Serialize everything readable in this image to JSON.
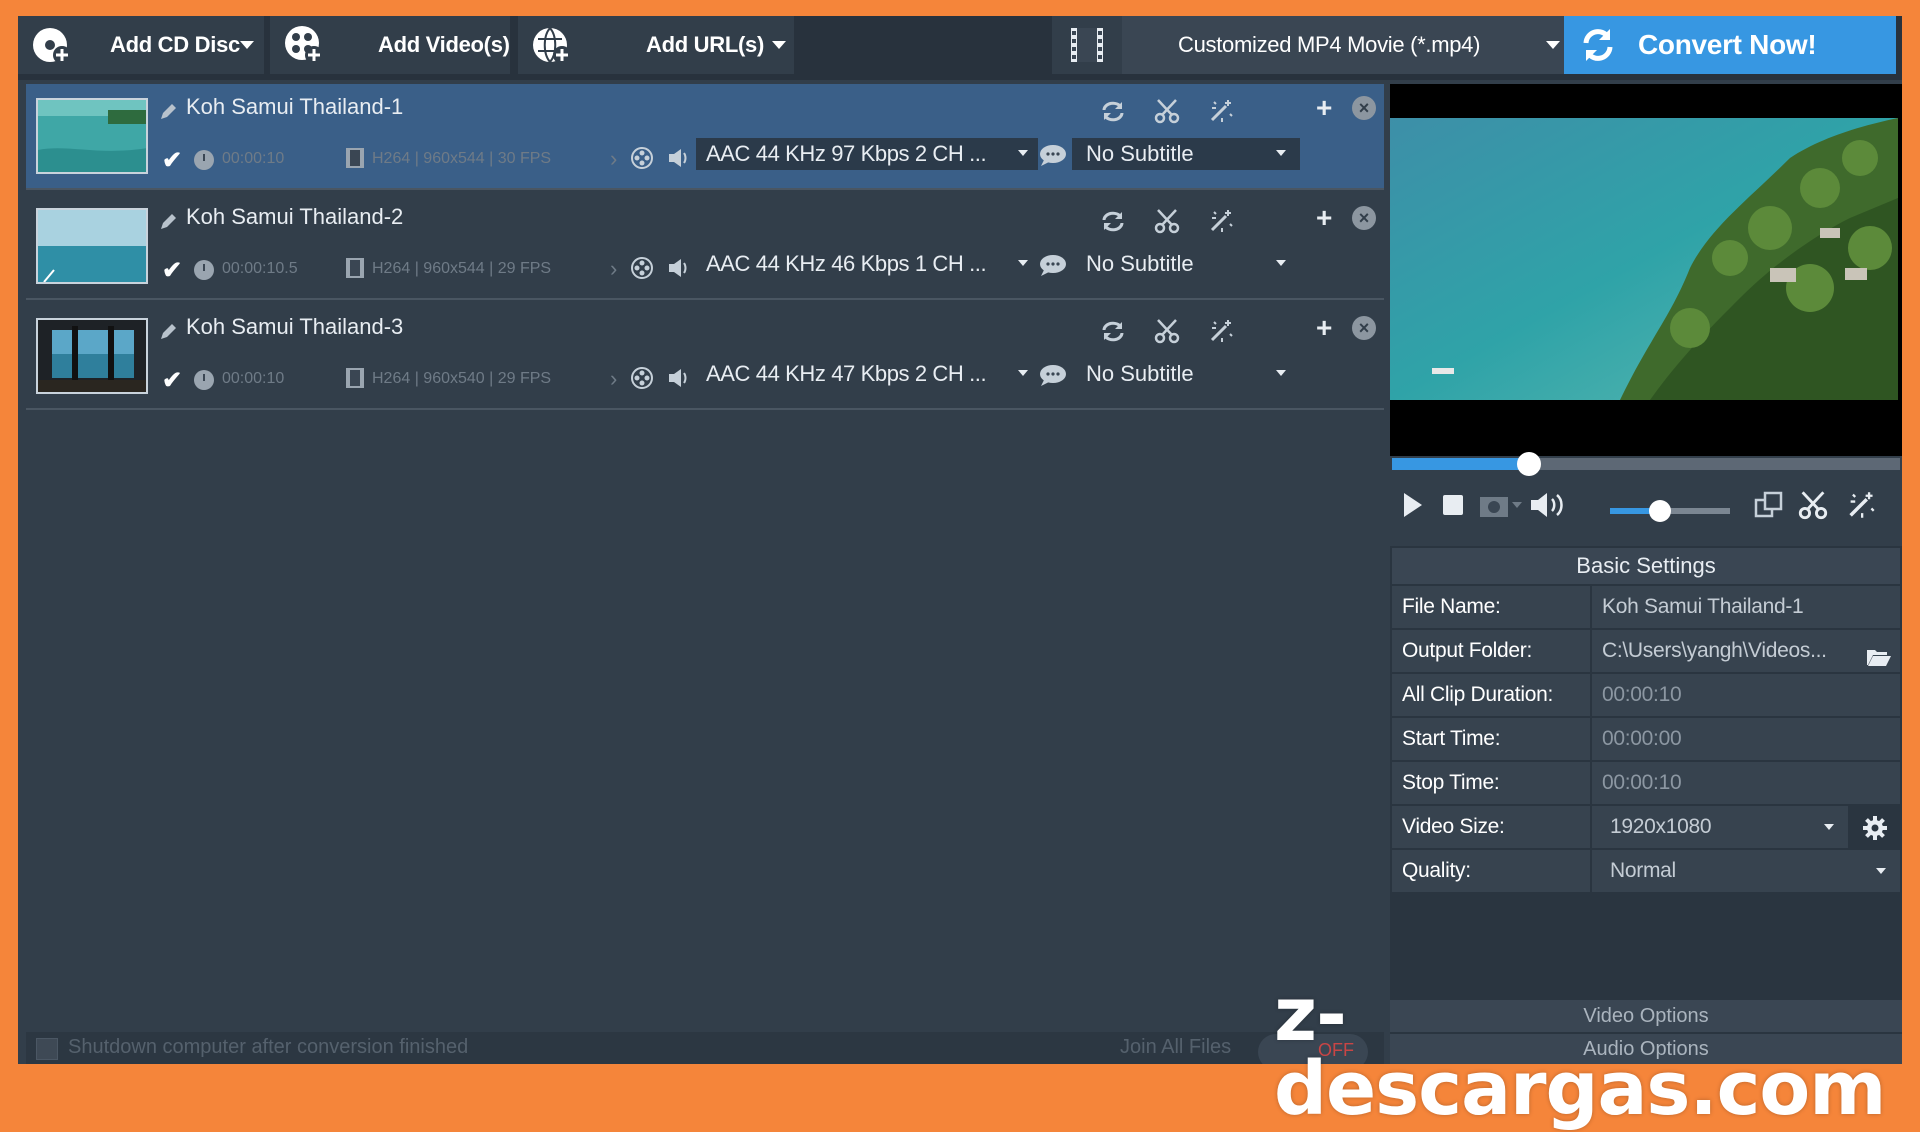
{
  "toolbar": {
    "add_cd_label": "Add CD Disc",
    "add_video_label": "Add Video(s)",
    "add_url_label": "Add URL(s)",
    "output_format": "Customized MP4 Movie (*.mp4)",
    "convert_label": "Convert Now!"
  },
  "files": [
    {
      "name": "Koh Samui Thailand-1",
      "checked": "✔",
      "duration": "00:00:10",
      "video_info": "H264 | 960x544 | 30 FPS",
      "audio": "AAC 44 KHz 97 Kbps 2 CH ...",
      "subtitle": "No Subtitle",
      "selected": true
    },
    {
      "name": "Koh Samui Thailand-2",
      "checked": "✔",
      "duration": "00:00:10.5",
      "video_info": "H264 | 960x544 | 29 FPS",
      "audio": "AAC 44 KHz 46 Kbps 1 CH ...",
      "subtitle": "No Subtitle",
      "selected": false
    },
    {
      "name": "Koh Samui Thailand-3",
      "checked": "✔",
      "duration": "00:00:10",
      "video_info": "H264 | 960x540 | 29 FPS",
      "audio": "AAC 44 KHz 47 Kbps 2 CH ...",
      "subtitle": "No Subtitle",
      "selected": false
    }
  ],
  "bottom": {
    "shutdown_label": "Shutdown computer after conversion finished",
    "join_label": "Join All Files",
    "join_state": "OFF"
  },
  "player": {
    "seek_progress": 0.27,
    "volume_level": 0.42
  },
  "settings": {
    "header": "Basic Settings",
    "rows": [
      {
        "label": "File Name:",
        "value": "Koh Samui Thailand-1"
      },
      {
        "label": "Output Folder:",
        "value": "C:\\Users\\yangh\\Videos..."
      },
      {
        "label": "All Clip Duration:",
        "value": "00:00:10"
      },
      {
        "label": "Start Time:",
        "value": "00:00:00"
      },
      {
        "label": "Stop Time:",
        "value": "00:00:10"
      },
      {
        "label": "Video Size:",
        "value": "1920x1080"
      },
      {
        "label": "Quality:",
        "value": "Normal"
      }
    ],
    "video_options_tab": "Video Options",
    "audio_options_tab": "Audio Options"
  },
  "watermark": "z-descargas.com",
  "colors": {
    "frame": "#f5853a",
    "accent": "#3797e2",
    "selected_row": "#3a5f88",
    "background": "#323e4a"
  }
}
